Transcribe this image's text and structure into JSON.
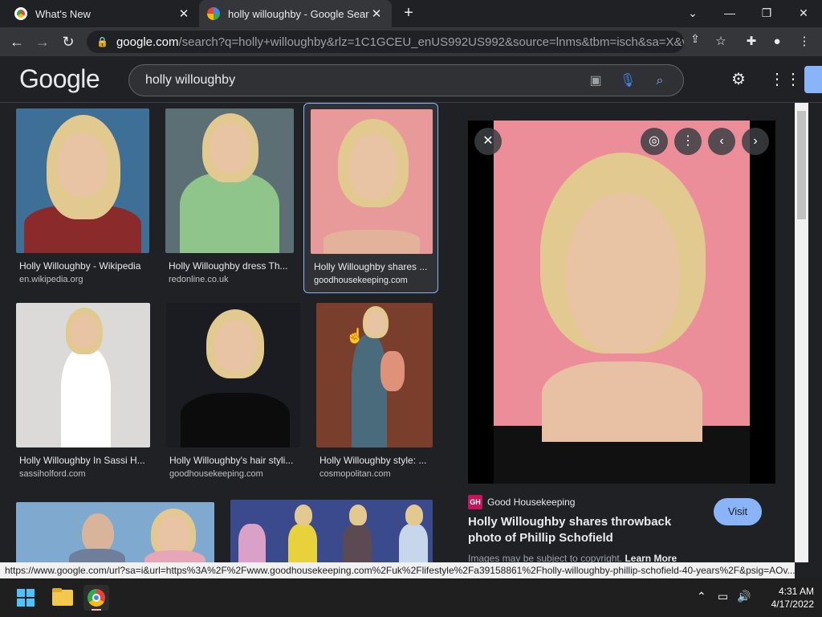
{
  "tabs": [
    {
      "title": "What's New",
      "active": false
    },
    {
      "title": "holly willoughby - Google Search",
      "active": true
    }
  ],
  "address": {
    "host": "google.com",
    "path": "/search?q=holly+willoughby&rlz=1C1GCEU_enUS992US992&source=lnms&tbm=isch&sa=X&ved=..."
  },
  "google": {
    "logo": "Google",
    "query": "holly willoughby"
  },
  "results": [
    {
      "title": "Holly Willoughby - Wikipedia",
      "source": "en.wikipedia.org"
    },
    {
      "title": "Holly Willoughby dress Th...",
      "source": "redonline.co.uk"
    },
    {
      "title": "Holly Willoughby shares ...",
      "source": "goodhousekeeping.com"
    },
    {
      "title": "Holly Willoughby In Sassi H...",
      "source": "sassiholford.com"
    },
    {
      "title": "Holly Willoughby's hair styli...",
      "source": "goodhousekeeping.com"
    },
    {
      "title": "Holly Willoughby style: ...",
      "source": "cosmopolitan.com"
    }
  ],
  "preview": {
    "badge": "GH",
    "source": "Good Housekeeping",
    "title": "Holly Willoughby shares throwback photo of Phillip Schofield",
    "visit_label": "Visit",
    "copyright": "Images may be subject to copyright.",
    "learn_more": "Learn More"
  },
  "status_url": "https://www.google.com/url?sa=i&url=https%3A%2F%2Fwww.goodhousekeeping.com%2Fuk%2Flifestyle%2Fa39158861%2Fholly-willoughby-phillip-schofield-40-years%2F&psig=AOv...",
  "clock": {
    "time": "4:31 AM",
    "date": "4/17/2022"
  },
  "colors": {
    "accent": "#8ab4f8",
    "background": "#202124"
  }
}
